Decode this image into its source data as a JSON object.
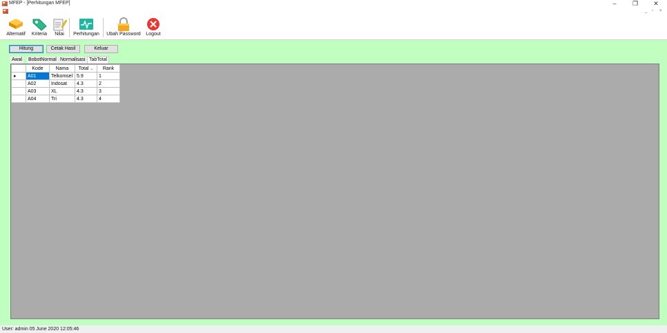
{
  "window": {
    "title": "MFEP - [Perhitungan MFEP]",
    "controls": {
      "minimize": "–",
      "restore": "❐",
      "close": "✕"
    },
    "mdi_controls": {
      "minimize": "_",
      "restore": "▫",
      "close": "×"
    }
  },
  "toolbar": {
    "items": [
      {
        "label": "Alternatif",
        "icon": "stack-layers-icon",
        "color": "#f5a623"
      },
      {
        "label": "Kriteria",
        "icon": "tag-icon",
        "color": "#2eb88a"
      },
      {
        "label": "Nilai",
        "icon": "notepad-pencil-icon",
        "color": "#f0c419"
      },
      {
        "label": "Perhitungan",
        "icon": "heartbeat-monitor-icon",
        "color": "#20b7a0"
      },
      {
        "label": "Ubah Password",
        "icon": "padlock-icon",
        "color": "#f5a623"
      },
      {
        "label": "Logout",
        "icon": "close-circle-icon",
        "color": "#e53935"
      }
    ]
  },
  "buttons": {
    "hitung": "Hitung",
    "cetak": "Cetak Hasil",
    "keluar": "Keluar"
  },
  "tabs": [
    "Awal",
    "BobotNormal",
    "Normalisasi",
    "TabTotal"
  ],
  "grid": {
    "columns": [
      "Kode",
      "Nama",
      "Total",
      "Rank"
    ],
    "sort_indicator": "⌄",
    "current_row_marker": "▸",
    "rows": [
      [
        "A01",
        "Telkomsel",
        "5.9",
        "1"
      ],
      [
        "A02",
        "Indosat",
        "4.3",
        "2"
      ],
      [
        "A03",
        "XL",
        "4.3",
        "3"
      ],
      [
        "A04",
        "Tri",
        "4.3",
        "4"
      ]
    ]
  },
  "status": {
    "text": "User: admin  05 June 2020 12:05:46"
  },
  "colors": {
    "client_bg": "#c0ffc0",
    "grid_bg": "#ababab",
    "selection": "#0078d7"
  }
}
